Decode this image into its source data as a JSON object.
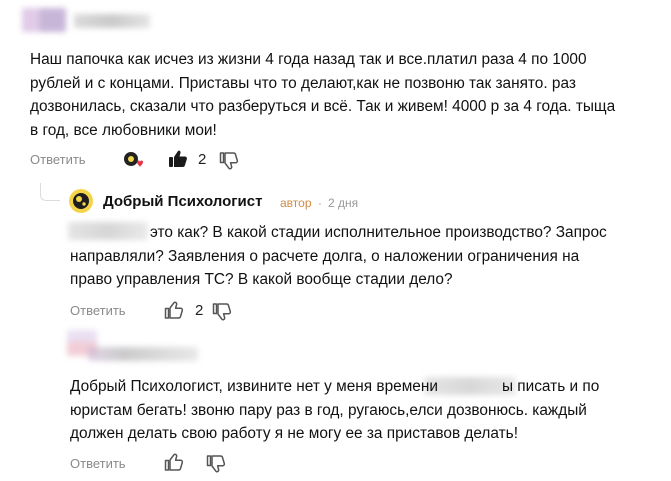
{
  "comments": [
    {
      "lines": [
        "Наш папочка как исчез из жизни 4 года назад так и все.платил раза 4 по 1000",
        "рублей и с концами. Приставы что то делают,как не позвоню так занято. раз",
        "дозвонилась, сказали что разберуться и всё. Так и живем! 4000 р за 4 года. тыща",
        "в год, все любовники мои!"
      ],
      "reply_label": "Ответить",
      "likes": "2"
    },
    {
      "author": "Добрый Психологист",
      "badge": "автор",
      "separator": "·",
      "date": "2 дня",
      "lines": [
        "это как? В какой стадии исполнительное производство? Запрос",
        "направляли? Заявления о расчете долга, о наложении ограничения на",
        "право управления ТС? В какой вообще стадии дело?"
      ],
      "reply_label": "Ответить",
      "likes": "2"
    },
    {
      "lines": [
        "Добрый Психологист, извините нет у меня времени",
        "ы писать и по",
        "юристам бегать! звоню пару раз в год, ругаюсь,елси дозвонюсь. каждый",
        "должен делать свою работу я не могу ее за приставов делать!"
      ],
      "reply_label": "Ответить"
    }
  ],
  "colors": {
    "accent_badge": "#d08a43",
    "muted": "#8a8a8a",
    "reaction_heart": "#e8344b"
  },
  "icons": [
    "like-filled-icon",
    "dislike-icon",
    "like-outline-icon",
    "reactions-icon",
    "author-avatar-icon"
  ]
}
